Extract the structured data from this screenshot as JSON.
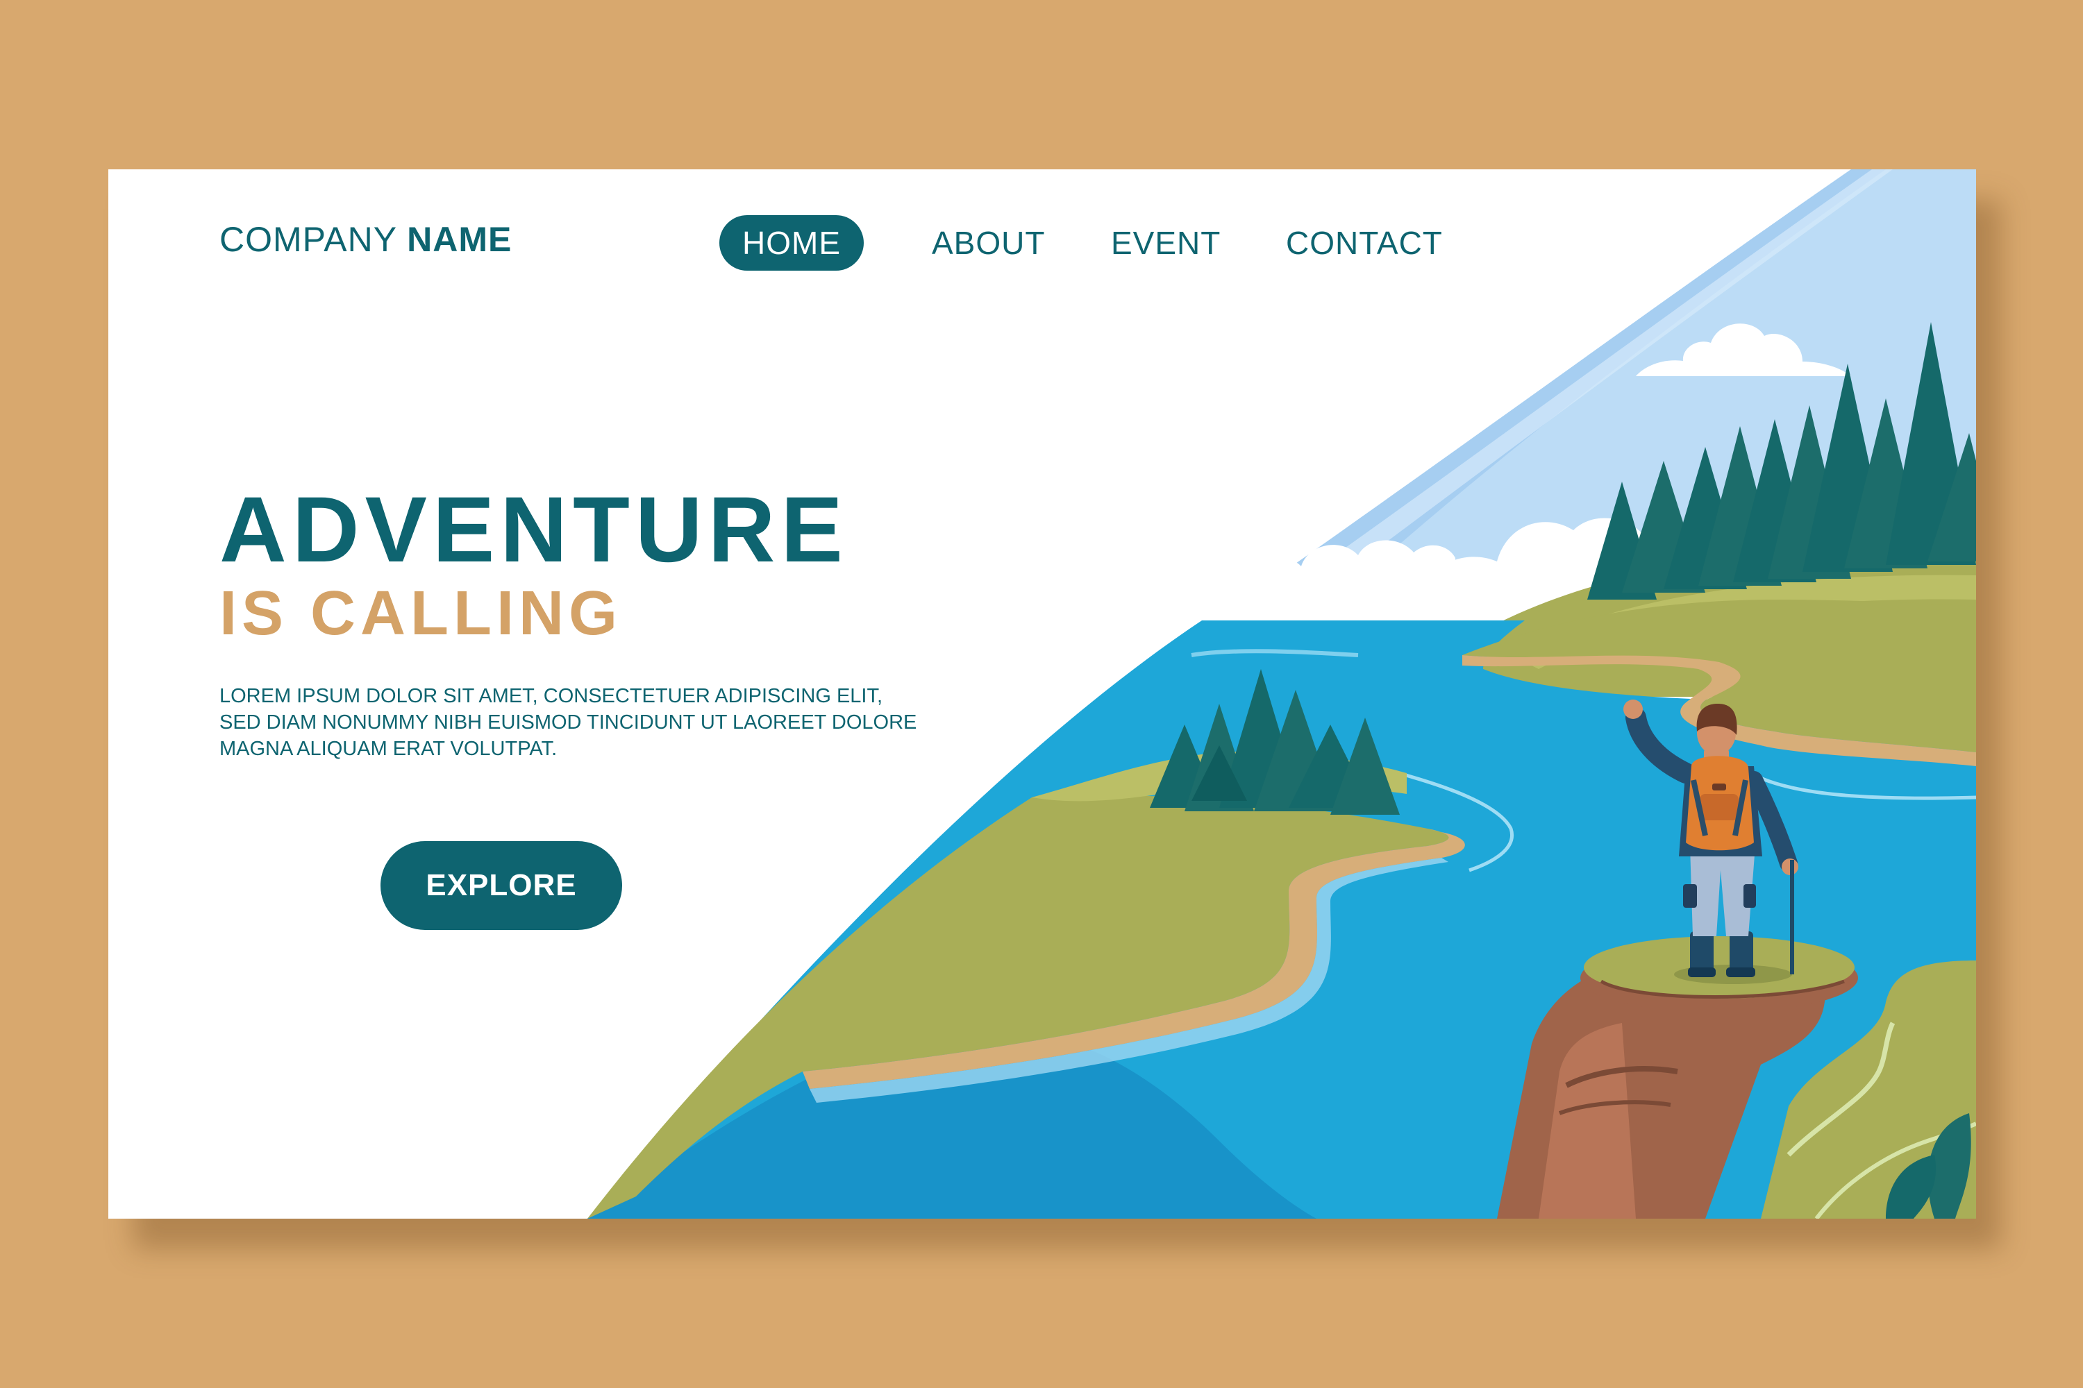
{
  "brand": {
    "light": "COMPANY",
    "bold": "NAME"
  },
  "nav": {
    "items": [
      {
        "label": "HOME",
        "active": true
      },
      {
        "label": "ABOUT",
        "active": false
      },
      {
        "label": "EVENT",
        "active": false
      },
      {
        "label": "CONTACT",
        "active": false
      }
    ]
  },
  "hero": {
    "title": "ADVENTURE",
    "subtitle": "IS CALLING",
    "body": "LOREM IPSUM DOLOR SIT AMET, CONSECTETUER ADIPISCING ELIT, SED DIAM NONUMMY NIBH EUISMOD TINCIDUNT UT LAOREET DOLORE MAGNA ALIQUAM ERAT VOLUTPAT.",
    "cta": "EXPLORE"
  },
  "colors": {
    "page_background": "#D8A86E",
    "primary": "#0E6470",
    "accent": "#D4A267",
    "water": "#1EA7D8",
    "sky": "#BCDCF6",
    "grass": "#A9AE57",
    "forest": "#1C6D6B"
  },
  "illustration": {
    "figure": "hiker-with-backpack-and-trekking-pole",
    "scene": "river-valley-with-forest-clouds-and-cliff"
  }
}
